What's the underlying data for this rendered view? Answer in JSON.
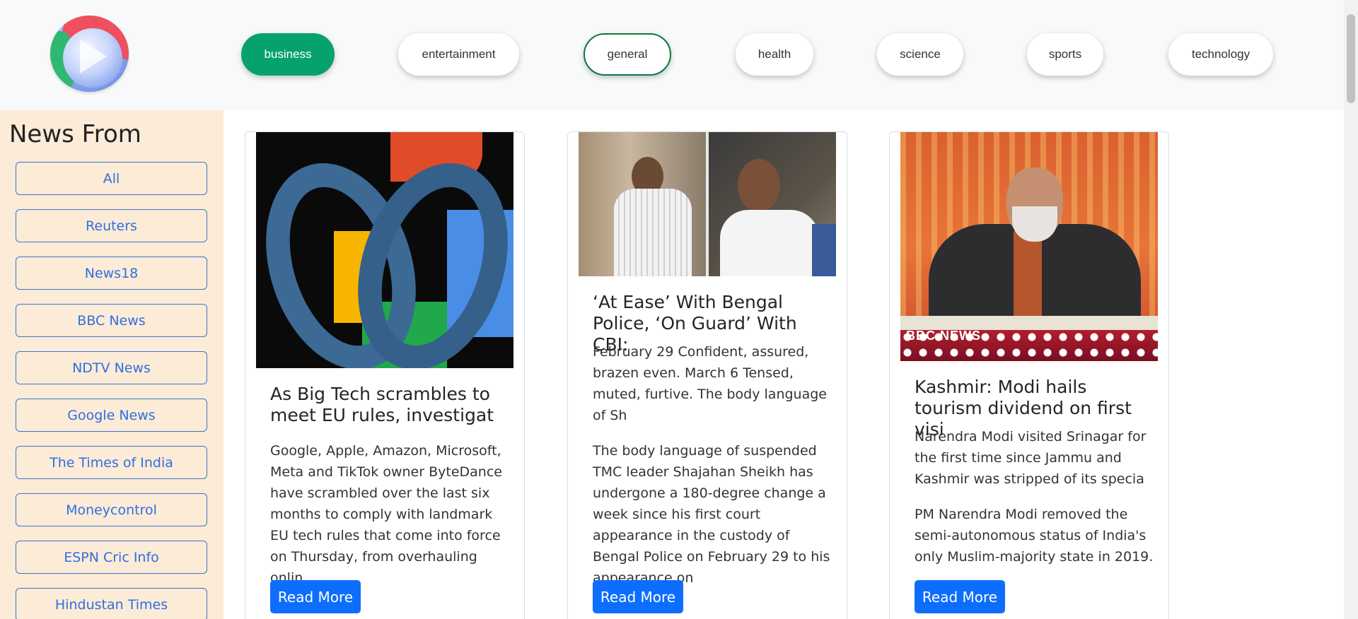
{
  "categories": [
    {
      "label": "business"
    },
    {
      "label": "entertainment"
    },
    {
      "label": "general"
    },
    {
      "label": "health"
    },
    {
      "label": "science"
    },
    {
      "label": "sports"
    },
    {
      "label": "technology"
    }
  ],
  "colors": {
    "active_category": "#06a26c",
    "sidebar_bg": "#fcebd7",
    "primary_button": "#0d6efd",
    "source_link": "#2f6fe0"
  },
  "sidebar": {
    "title": "News From",
    "sources": [
      "All",
      "Reuters",
      "News18",
      "BBC News",
      "NDTV News",
      "Google News",
      "The Times of India",
      "Moneycontrol",
      "ESPN Cric Info",
      "Hindustan Times"
    ]
  },
  "articles": [
    {
      "title": "As Big Tech scrambles to meet EU rules, investigat",
      "description": "Google, Apple, Amazon, Microsoft, Meta and TikTok owner ByteDance have scrambled over the last six months to comply with landmark EU tech rules that come into force on Thursday, from overhauling onlin",
      "content": "",
      "button": "Read More"
    },
    {
      "title": "‘At Ease’ With Bengal Police, ‘On Guard’ With CBI:",
      "description": "February 29 Confident, assured, brazen even. March 6 Tensed, muted, furtive. The body language of Sh",
      "content": "The body language of suspended TMC leader Shajahan Sheikh has undergone a 180-degree change a week since his first court appearance in the custody of Bengal Police on February 29 to his appearance on",
      "button": "Read More"
    },
    {
      "title": "Kashmir: Modi hails tourism dividend on first visi",
      "description": "Narendra Modi visited Srinagar for the first time since Jammu and Kashmir was stripped of its specia",
      "content": "PM Narendra Modi removed the semi-autonomous status of India's only Muslim-majority state in 2019.",
      "button": "Read More",
      "image_watermark": "BBC NEWS"
    }
  ]
}
